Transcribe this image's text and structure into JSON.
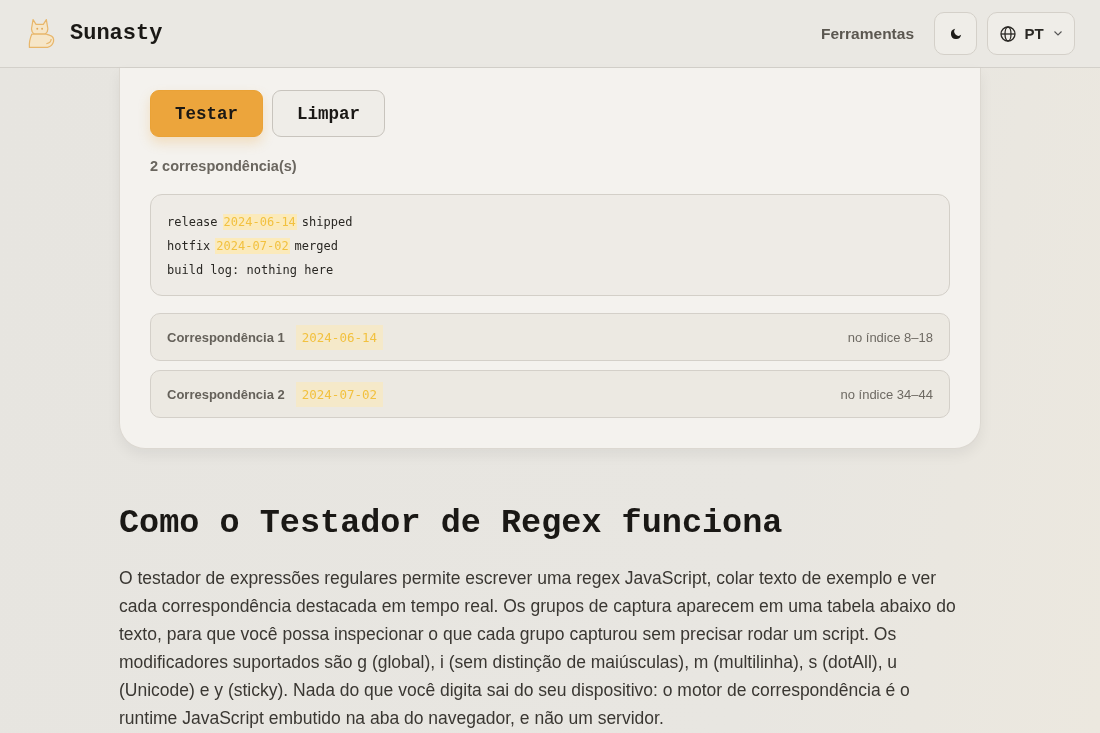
{
  "header": {
    "brand": "Sunasty",
    "nav_link": "Ferramentas",
    "language": "PT"
  },
  "tester": {
    "buttons": [
      {
        "label": "Testar",
        "kind": "primary"
      },
      {
        "label": "Limpar",
        "kind": "secondary"
      }
    ],
    "match_count": "2 correspondência(s)",
    "test_text": [
      [
        {
          "text": "release",
          "match": false
        },
        {
          "text": "2024-06-14",
          "match": true
        },
        {
          "text": "shipped",
          "match": false
        }
      ],
      [
        {
          "text": "hotfix",
          "match": false
        },
        {
          "text": "2024-07-02",
          "match": true
        },
        {
          "text": "merged",
          "match": false
        }
      ],
      [
        {
          "text": "build log: nothing here",
          "match": false
        }
      ]
    ],
    "matches": [
      {
        "label": "Correspondência 1",
        "value": "2024-06-14",
        "position": "no índice 8–18"
      },
      {
        "label": "Correspondência 2",
        "value": "2024-07-02",
        "position": "no índice 34–44"
      }
    ]
  },
  "article": {
    "heading": "Como o Testador de Regex funciona",
    "paragraph": "O testador de expressões regulares permite escrever uma regex JavaScript, colar texto de exemplo e ver cada correspondência destacada em tempo real. Os grupos de captura aparecem em uma tabela abaixo do texto, para que você possa inspecionar o que cada grupo capturou sem precisar rodar um script. Os modificadores suportados são g (global), i (sem distinção de maiúsculas), m (multilinha), s (dotAll), u (Unicode) e y (sticky). Nada do que você digita sai do seu dispositivo: o motor de correspondência é o runtime JavaScript embutido na aba do navegador, e não um servidor."
  }
}
